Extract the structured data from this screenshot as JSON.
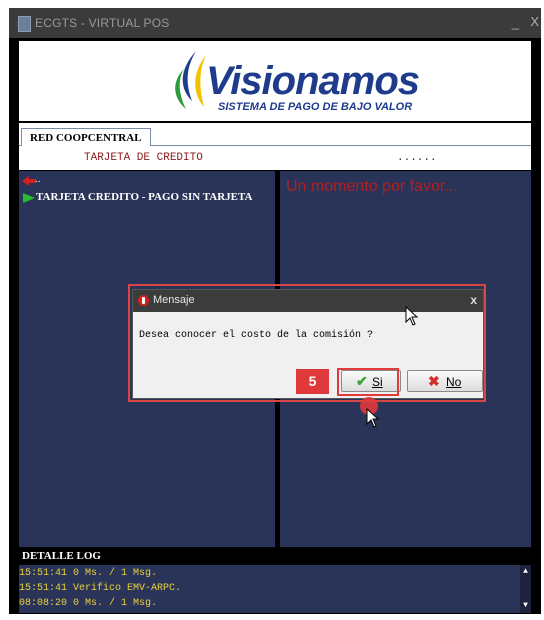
{
  "window": {
    "title": "ECGTS - VIRTUAL POS",
    "minimize": "_",
    "close": "X"
  },
  "logo": {
    "brand": "Visionamos",
    "tagline": "SISTEMA DE PAGO DE BAJO VALOR"
  },
  "tabs": [
    {
      "label": "RED COOPCENTRAL"
    }
  ],
  "transaction": {
    "name": "TARJETA DE CREDITO",
    "progress_dots": "......"
  },
  "left_panel": {
    "back_label": "..",
    "menu_item": "TARJETA CREDITO - PAGO SIN TARJETA"
  },
  "right_panel": {
    "status": "Un momento por favor..."
  },
  "dialog": {
    "title": "Mensaje",
    "close": "x",
    "message": "Desea conocer el costo de la comisión ?",
    "yes_icon": "✔",
    "yes_label": "Si",
    "no_icon": "✖",
    "no_label": "No"
  },
  "step": {
    "number": "5"
  },
  "log": {
    "header": "DETALLE LOG",
    "lines": [
      "15:51:41 0 Ms. / 1 Msg.",
      "15:51:41 Verifico EMV-ARPC.",
      "08:08:20 0 Ms. / 1 Msg."
    ]
  },
  "colors": {
    "panel_bg": "#2a3358",
    "status_red": "#b02020",
    "log_yellow": "#e8d33a",
    "brand_blue": "#1f3c8c",
    "annotation_red": "#e0393b"
  }
}
